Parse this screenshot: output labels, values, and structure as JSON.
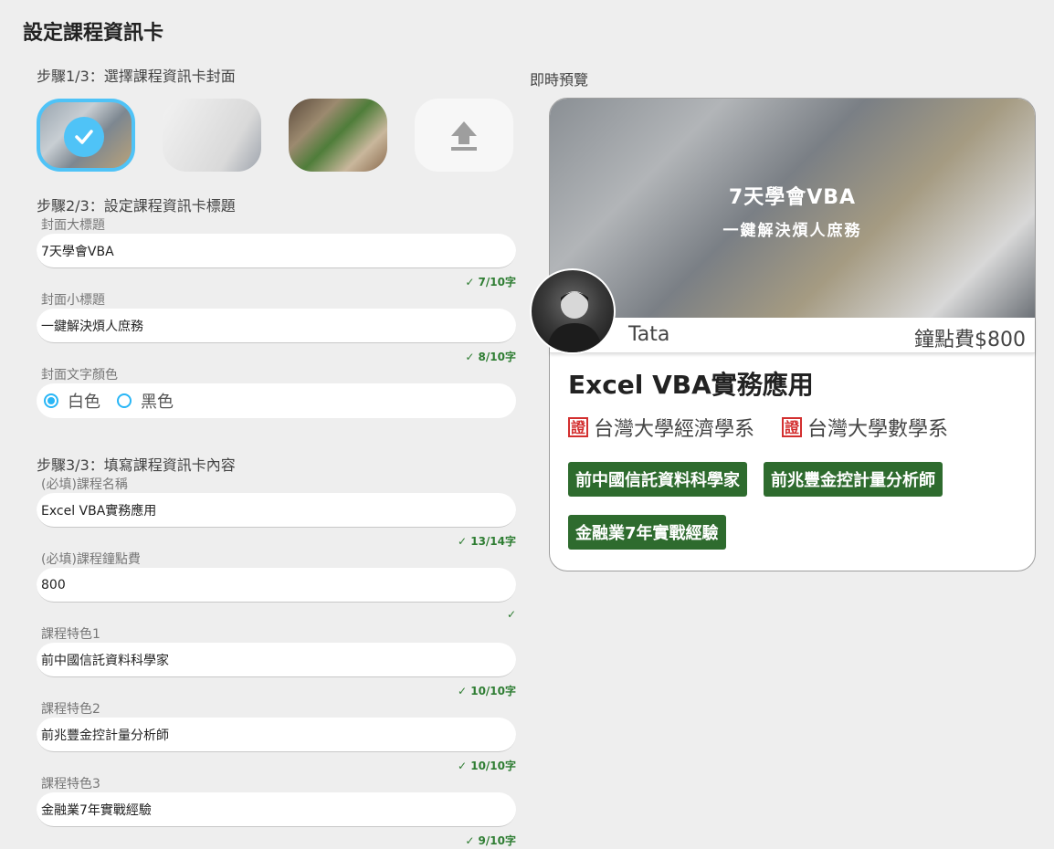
{
  "page_title": "設定課程資訊卡",
  "step1": {
    "label": "步驟1/3：選擇課程資訊卡封面"
  },
  "step2": {
    "label": "步驟2/3：設定課程資訊卡標題",
    "title_label": "封面大標題",
    "title_value": "7天學會VBA",
    "title_counter": "✓ 7/10字",
    "subtitle_label": "封面小標題",
    "subtitle_value": "一鍵解決煩人庶務",
    "subtitle_counter": "✓ 8/10字",
    "color_label": "封面文字顏色",
    "color_white": "白色",
    "color_black": "黑色"
  },
  "step3": {
    "label": "步驟3/3：填寫課程資訊卡內容",
    "name_label": "(必填)課程名稱",
    "name_value": "Excel VBA實務應用",
    "name_counter": "✓ 13/14字",
    "fee_label": "(必填)課程鐘點費",
    "fee_value": "800",
    "fee_counter": "✓",
    "feature1_label": "課程特色1",
    "feature1_value": "前中國信託資料科學家",
    "feature1_counter": "✓ 10/10字",
    "feature2_label": "課程特色2",
    "feature2_value": "前兆豐金控計量分析師",
    "feature2_counter": "✓ 10/10字",
    "feature3_label": "課程特色3",
    "feature3_value": "金融業7年實戰經驗",
    "feature3_counter": "✓ 9/10字"
  },
  "preview": {
    "label": "即時預覽",
    "cover_title": "7天學會VBA",
    "cover_subtitle": "一鍵解決煩人庶務",
    "teacher_name": "Tata",
    "price": "鐘點費$800",
    "course_name": "Excel VBA實務應用",
    "cert_icon_text": "證",
    "certs": [
      "台灣大學經濟學系",
      "台灣大學數學系"
    ],
    "features": [
      "前中國信託資料科學家",
      "前兆豐金控計量分析師",
      "金融業7年實戰經驗"
    ]
  },
  "colors": {
    "accent": "#4fc3f7",
    "feature_bg": "#2e6b2e",
    "check_green": "#2e7d32",
    "cert_red": "#d32f2f"
  }
}
